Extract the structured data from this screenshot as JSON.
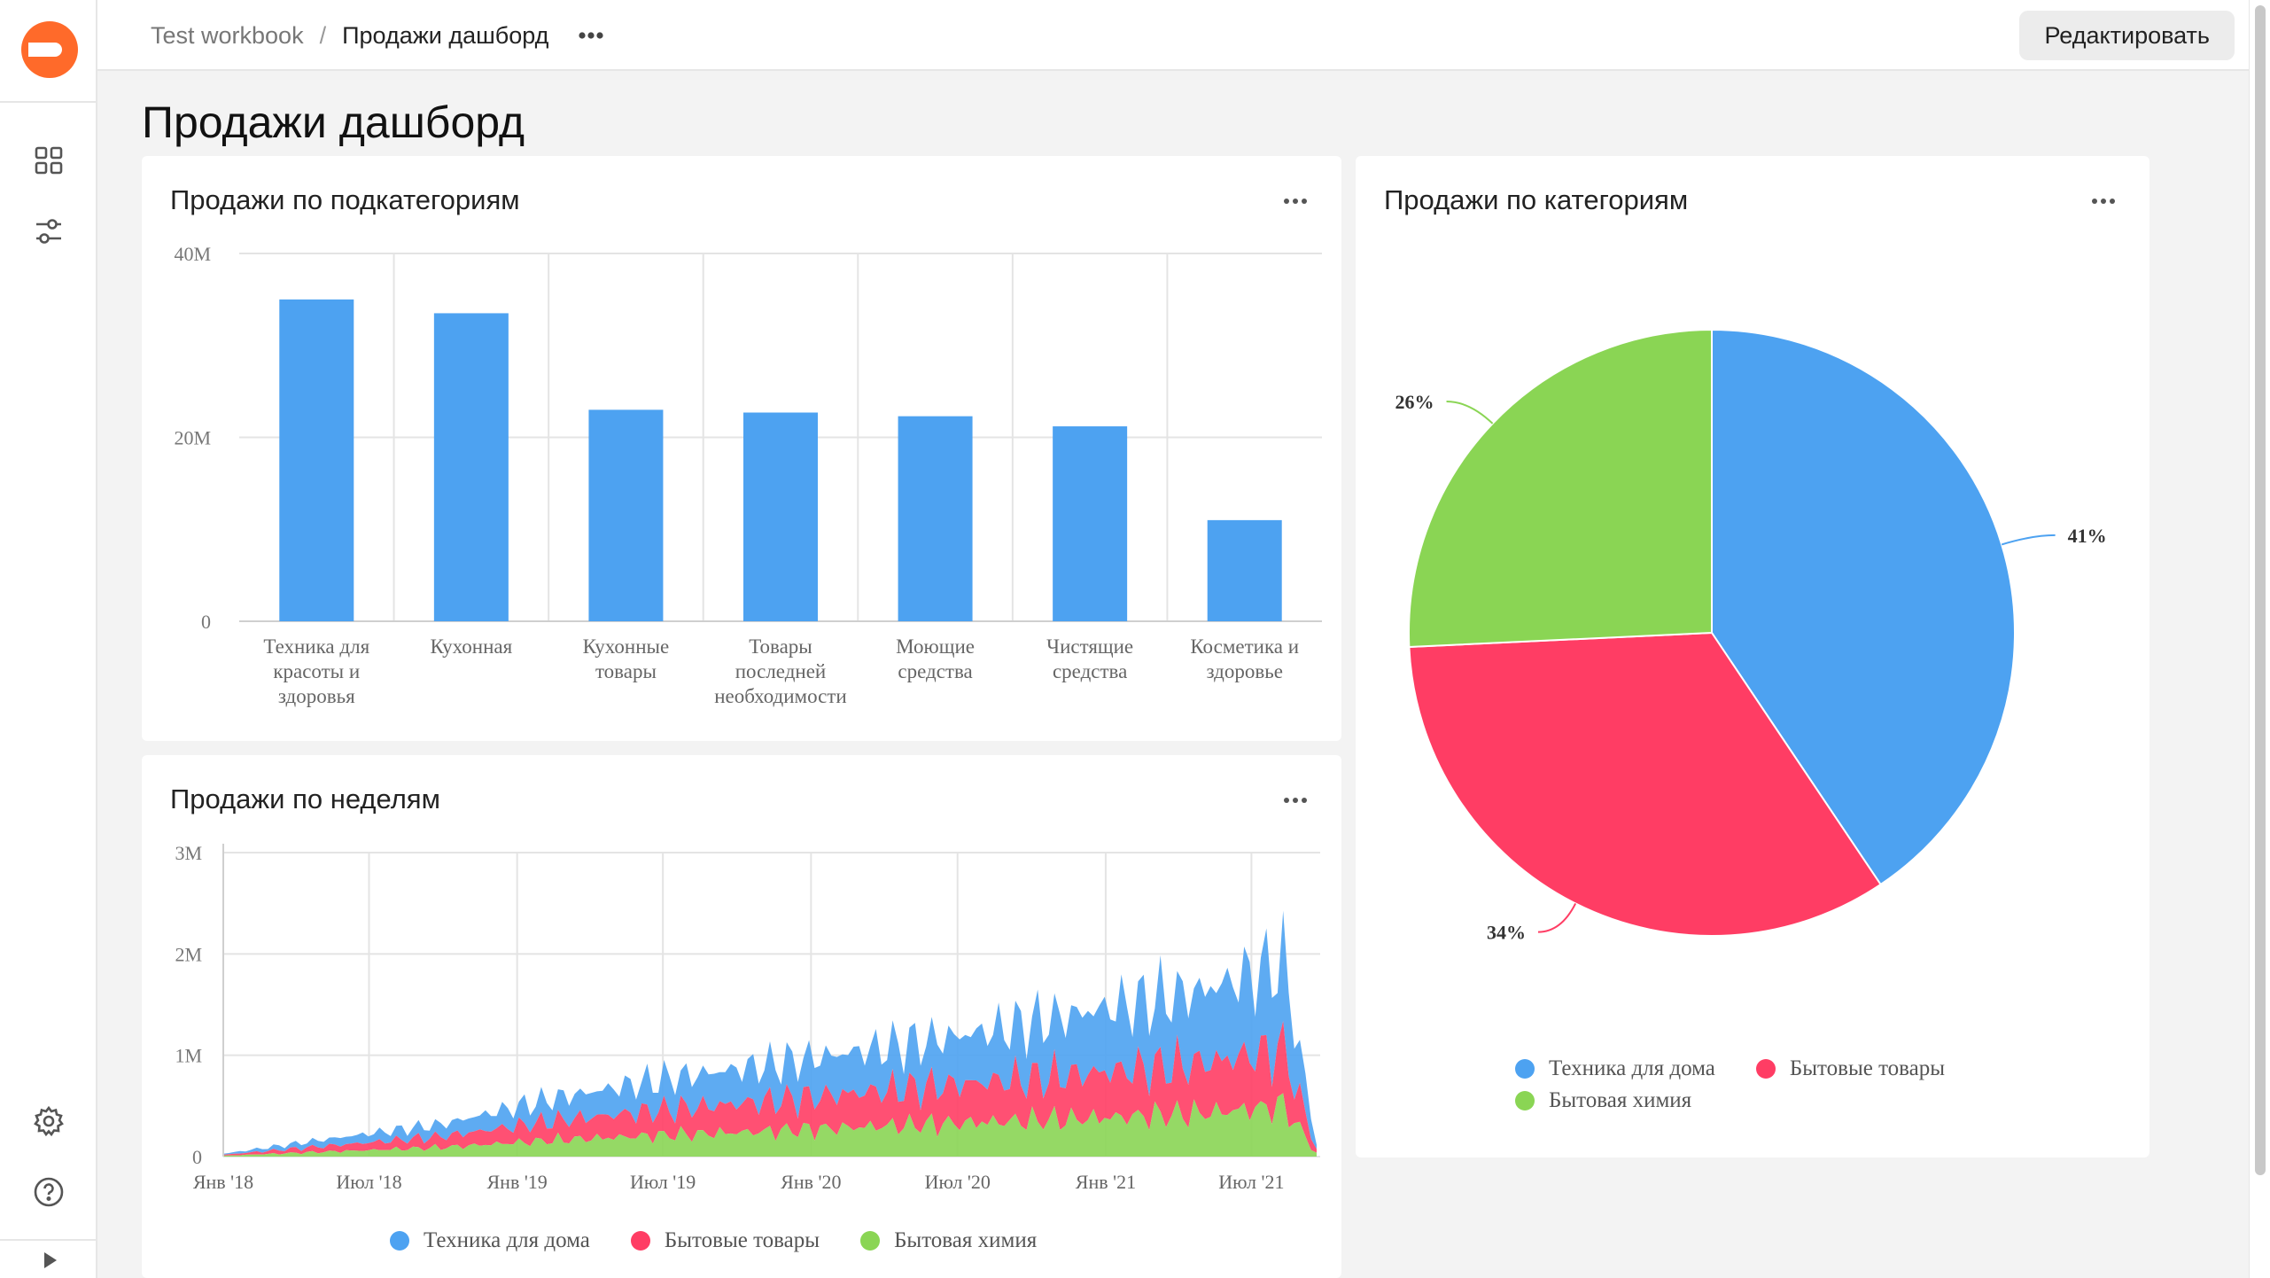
{
  "breadcrumb": {
    "workbook": "Test workbook",
    "separator": "/",
    "current": "Продажи дашборд"
  },
  "topbar": {
    "edit_label": "Редактировать"
  },
  "page": {
    "title": "Продажи дашборд"
  },
  "sidebar": {
    "icons": [
      "dashboard-icon",
      "sliders-icon",
      "settings-icon",
      "help-icon",
      "collapse-icon"
    ]
  },
  "colors": {
    "accent": "#ff6a2a",
    "blue": "#4da2f1",
    "red": "#ff3d64",
    "green": "#8ad554"
  },
  "widgets": {
    "subcategories": {
      "title": "Продажи по подкатегориям"
    },
    "weekly": {
      "title": "Продажи по неделям"
    },
    "categories": {
      "title": "Продажи по категориям"
    }
  },
  "chart_data": [
    {
      "type": "bar",
      "title": "Продажи по подкатегориям",
      "categories": [
        [
          "Техника для",
          "красоты и",
          "здоровья"
        ],
        [
          "Кухонная"
        ],
        [
          "Кухонные",
          "товары"
        ],
        [
          "Товары",
          "последней",
          "необходимости"
        ],
        [
          "Моющие",
          "средства"
        ],
        [
          "Чистящие",
          "средства"
        ],
        [
          "Косметика и",
          "здоровье"
        ]
      ],
      "values": [
        35000000,
        33500000,
        23000000,
        22700000,
        22300000,
        21200000,
        11000000
      ],
      "ylim": [
        0,
        40000000
      ],
      "yticks": [
        {
          "v": 0,
          "label": "0"
        },
        {
          "v": 20000000,
          "label": "20M"
        },
        {
          "v": 40000000,
          "label": "40M"
        }
      ],
      "color": "#4da2f1",
      "grid": true
    },
    {
      "type": "area",
      "title": "Продажи по неделям",
      "stacked": true,
      "xlim": [
        "2018-01-01",
        "2021-09-20"
      ],
      "xticks": [
        {
          "date": "2018-01-01",
          "label": "Янв '18"
        },
        {
          "date": "2018-07-01",
          "label": "Июл '18"
        },
        {
          "date": "2019-01-01",
          "label": "Янв '19"
        },
        {
          "date": "2019-07-01",
          "label": "Июл '19"
        },
        {
          "date": "2020-01-01",
          "label": "Янв '20"
        },
        {
          "date": "2020-07-01",
          "label": "Июл '20"
        },
        {
          "date": "2021-01-01",
          "label": "Янв '21"
        },
        {
          "date": "2021-07-01",
          "label": "Июл '21"
        }
      ],
      "ylim": [
        0,
        3000000
      ],
      "yticks": [
        {
          "v": 0,
          "label": "0"
        },
        {
          "v": 1000000,
          "label": "1M"
        },
        {
          "v": 2000000,
          "label": "2M"
        },
        {
          "v": 3000000,
          "label": "3M"
        }
      ],
      "grid": true,
      "legend": "bottom",
      "series": [
        {
          "name": "Техника для дома",
          "color": "#4da2f1",
          "trend": [
            [
              0,
              10000
            ],
            [
              0.1,
              70000
            ],
            [
              0.2,
              120000
            ],
            [
              0.3,
              220000
            ],
            [
              0.4,
              300000
            ],
            [
              0.5,
              360000
            ],
            [
              0.6,
              420000
            ],
            [
              0.7,
              500000
            ],
            [
              0.8,
              620000
            ],
            [
              0.9,
              720000
            ],
            [
              0.97,
              860000
            ],
            [
              1.0,
              50000
            ]
          ]
        },
        {
          "name": "Бытовые товары",
          "color": "#ff3d64",
          "trend": [
            [
              0,
              10000
            ],
            [
              0.1,
              60000
            ],
            [
              0.2,
              110000
            ],
            [
              0.3,
              190000
            ],
            [
              0.4,
              250000
            ],
            [
              0.5,
              300000
            ],
            [
              0.6,
              350000
            ],
            [
              0.7,
              400000
            ],
            [
              0.8,
              450000
            ],
            [
              0.9,
              500000
            ],
            [
              0.97,
              560000
            ],
            [
              1.0,
              40000
            ]
          ]
        },
        {
          "name": "Бытовая химия",
          "color": "#8ad554",
          "trend": [
            [
              0,
              8000
            ],
            [
              0.1,
              50000
            ],
            [
              0.2,
              90000
            ],
            [
              0.3,
              160000
            ],
            [
              0.4,
              210000
            ],
            [
              0.5,
              250000
            ],
            [
              0.6,
              300000
            ],
            [
              0.7,
              340000
            ],
            [
              0.8,
              380000
            ],
            [
              0.9,
              430000
            ],
            [
              0.97,
              500000
            ],
            [
              1.0,
              30000
            ]
          ]
        }
      ]
    },
    {
      "type": "pie",
      "title": "Продажи по категориям",
      "slices": [
        {
          "name": "Техника для дома",
          "value": 41,
          "label": "41%",
          "color": "#4da2f1"
        },
        {
          "name": "Бытовые товары",
          "value": 34,
          "label": "34%",
          "color": "#ff3d64"
        },
        {
          "name": "Бытовая химия",
          "value": 26,
          "label": "26%",
          "color": "#8ad554"
        }
      ],
      "legend": "bottom"
    }
  ]
}
